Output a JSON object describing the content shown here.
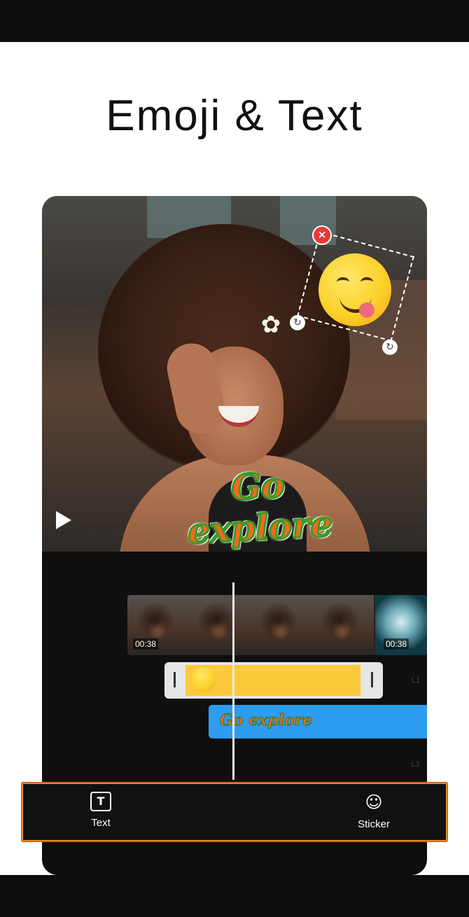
{
  "headline": "Emoji & Text",
  "preview": {
    "overlay_text": "Go explore",
    "close_glyph": "×",
    "rotate_glyph": "↻",
    "daisy_glyph": "✿"
  },
  "timeline": {
    "clip_durations": [
      "00:38",
      "00:38"
    ],
    "text_track_label": "Go explore",
    "layer_tags": [
      "L1",
      "L1"
    ]
  },
  "toolbar": {
    "text_label": "Text",
    "text_icon_glyph": "T",
    "sticker_label": "Sticker",
    "sticker_icon_glyph": "☺"
  },
  "colors": {
    "toolbar_border": "#d9622a",
    "sticker_track": "#fcc93b",
    "text_track": "#2e9cf0",
    "close_button": "#e83a3a"
  }
}
